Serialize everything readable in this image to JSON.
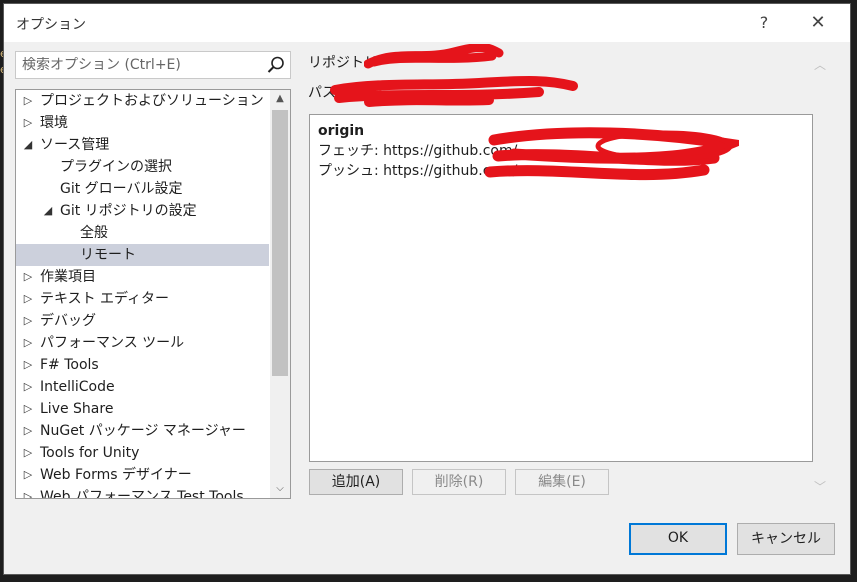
{
  "dialog": {
    "title": "オプション",
    "help_label": "?",
    "close_label": "✕"
  },
  "search": {
    "placeholder": "検索オプション (Ctrl+E)"
  },
  "tree": {
    "items": [
      {
        "label": "プロジェクトおよびソリューション",
        "arrow": "▷",
        "selected": false
      },
      {
        "label": "環境",
        "arrow": "▷",
        "selected": false
      },
      {
        "label": "ソース管理",
        "arrow": "◢",
        "selected": false
      },
      {
        "label": "プラグインの選択",
        "arrow": "",
        "selected": false
      },
      {
        "label": "Git グローバル設定",
        "arrow": "",
        "selected": false
      },
      {
        "label": "Git リポジトリの設定",
        "arrow": "◢",
        "selected": false
      },
      {
        "label": "全般",
        "arrow": "",
        "selected": false
      },
      {
        "label": "リモート",
        "arrow": "",
        "selected": true
      },
      {
        "label": "作業項目",
        "arrow": "▷",
        "selected": false
      },
      {
        "label": "テキスト エディター",
        "arrow": "▷",
        "selected": false
      },
      {
        "label": "デバッグ",
        "arrow": "▷",
        "selected": false
      },
      {
        "label": "パフォーマンス ツール",
        "arrow": "▷",
        "selected": false
      },
      {
        "label": "F# Tools",
        "arrow": "▷",
        "selected": false
      },
      {
        "label": "IntelliCode",
        "arrow": "▷",
        "selected": false
      },
      {
        "label": "Live Share",
        "arrow": "▷",
        "selected": false
      },
      {
        "label": "NuGet パッケージ マネージャー",
        "arrow": "▷",
        "selected": false
      },
      {
        "label": "Tools for Unity",
        "arrow": "▷",
        "selected": false
      },
      {
        "label": "Web Forms デザイナー",
        "arrow": "▷",
        "selected": false
      },
      {
        "label": "Web パフォーマンス Test Tools",
        "arrow": "▷",
        "selected": false
      }
    ],
    "scroll_up": "▲",
    "scroll_down": "⌵"
  },
  "content": {
    "heading_label": "リポジトリ",
    "path_label": "パス:",
    "path_value": "D",
    "remotes": [
      {
        "name": "origin",
        "fetch": "フェッチ: https://github.com/",
        "push": "プッシュ: https://github.com/"
      }
    ]
  },
  "actions": {
    "add_label": "追加(A)",
    "delete_label": "削除(R)",
    "edit_label": "編集(E)"
  },
  "footer": {
    "ok_label": "OK",
    "cancel_label": "キャンセル"
  },
  "colors": {
    "selection": "#ccd0dc",
    "accent": "#0078d7",
    "link": "#1565c0",
    "redaction": "#e5141b"
  }
}
